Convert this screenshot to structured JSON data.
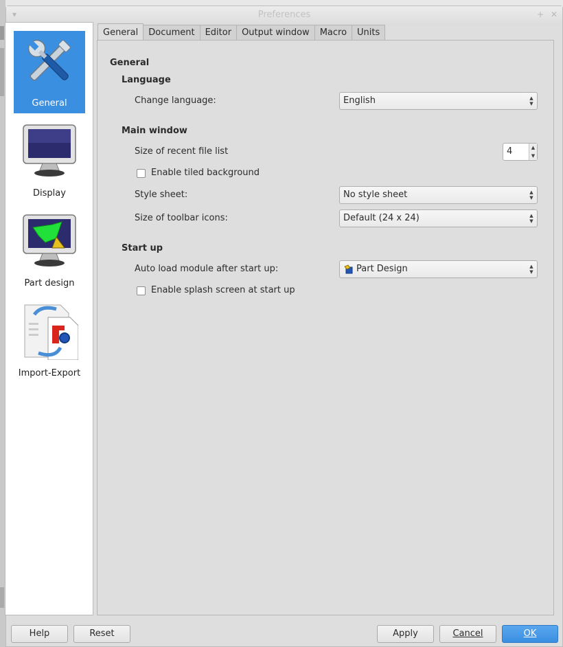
{
  "window": {
    "title": "Preferences"
  },
  "sidebar": {
    "items": [
      {
        "label": "General",
        "icon": "tools-icon",
        "active": true
      },
      {
        "label": "Display",
        "icon": "monitor-icon",
        "active": false
      },
      {
        "label": "Part design",
        "icon": "part-design-monitor-icon",
        "active": false
      },
      {
        "label": "Import-Export",
        "icon": "import-export-icon",
        "active": false
      }
    ]
  },
  "tabs": [
    {
      "label": "General",
      "active": true
    },
    {
      "label": "Document",
      "active": false
    },
    {
      "label": "Editor",
      "active": false
    },
    {
      "label": "Output window",
      "active": false
    },
    {
      "label": "Macro",
      "active": false
    },
    {
      "label": "Units",
      "active": false
    }
  ],
  "panel": {
    "heading": "General",
    "language": {
      "heading": "Language",
      "change_label": "Change language:",
      "change_value": "English"
    },
    "main_window": {
      "heading": "Main window",
      "recent_label": "Size of recent file list",
      "recent_value": "4",
      "tiled_label": "Enable tiled background",
      "tiled_checked": false,
      "style_label": "Style sheet:",
      "style_value": "No style sheet",
      "icons_label": "Size of toolbar icons:",
      "icons_value": "Default (24 x 24)"
    },
    "startup": {
      "heading": "Start up",
      "autoload_label": "Auto load module after start up:",
      "autoload_value": "Part Design",
      "splash_label": "Enable splash screen at start up",
      "splash_checked": false
    }
  },
  "buttons": {
    "help": "Help",
    "reset": "Reset",
    "apply": "Apply",
    "cancel": "Cancel",
    "ok": "OK"
  },
  "colors": {
    "accent": "#3a8fe0",
    "active_sidebar": "#3a8fe0"
  }
}
